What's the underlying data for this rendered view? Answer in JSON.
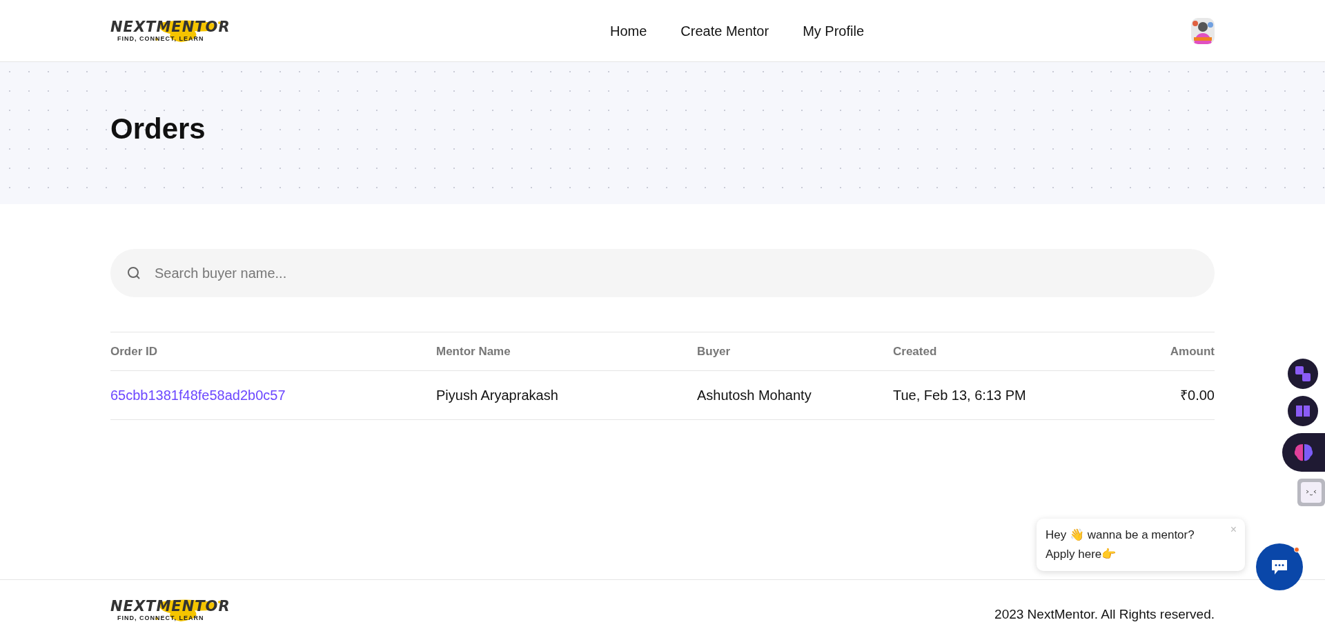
{
  "header": {
    "logo": {
      "name": "NEXTMENTOR",
      "tagline": "FIND, CONNECT, LEARN"
    },
    "nav": [
      {
        "label": "Home"
      },
      {
        "label": "Create Mentor"
      },
      {
        "label": "My Profile"
      }
    ]
  },
  "page": {
    "title": "Orders"
  },
  "search": {
    "placeholder": "Search buyer name..."
  },
  "table": {
    "columns": [
      "Order ID",
      "Mentor Name",
      "Buyer",
      "Created",
      "Amount"
    ],
    "rows": [
      {
        "order_id": "65cbb1381f48fe58ad2b0c57",
        "mentor_name": "Piyush Aryaprakash",
        "buyer": "Ashutosh Mohanty",
        "created": "Tue, Feb 13, 6:13 PM",
        "amount": "₹0.00"
      }
    ]
  },
  "footer": {
    "logo": {
      "name": "NEXTMENTOR",
      "tagline": "FIND, CONNECT, LEARN"
    },
    "copyright": "2023 NextMentor. All Rights reserved."
  },
  "chat_popup": {
    "lines": [
      "Hey 👋 wanna be a mentor?",
      "Apply here👉"
    ],
    "close": "×",
    "unread": true
  }
}
